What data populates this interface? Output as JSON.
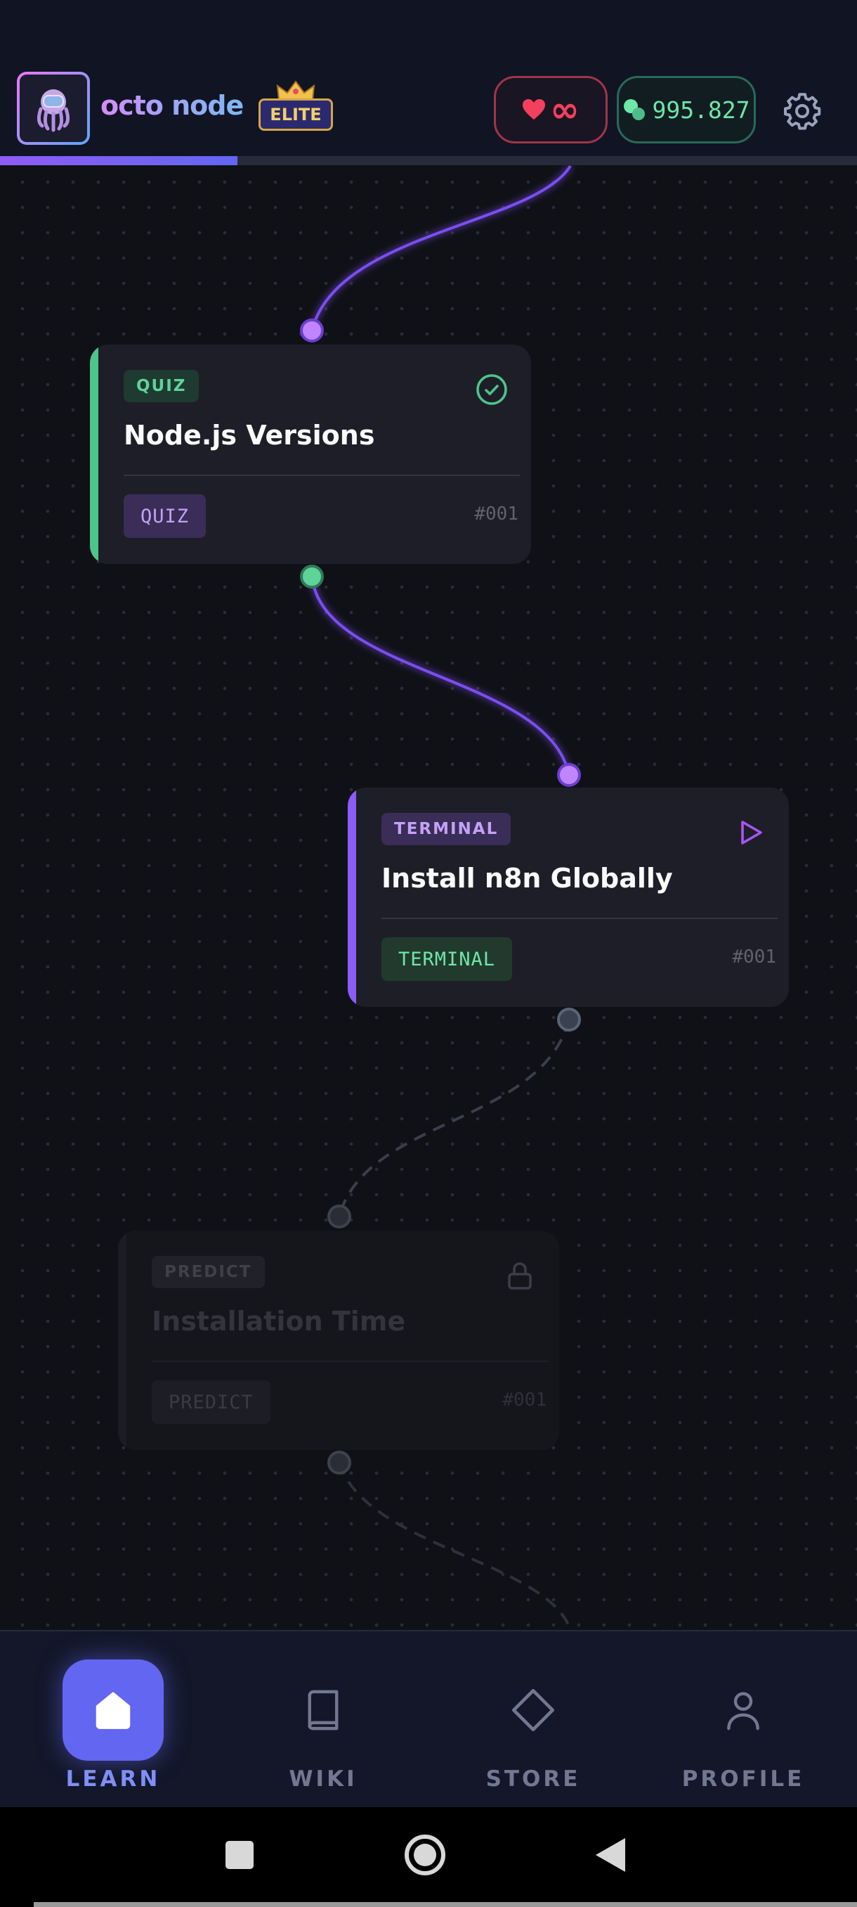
{
  "app": {
    "brand_name": "octo node",
    "elite_label": "ELITE"
  },
  "stats": {
    "hearts_value": "∞",
    "gems_value": "995.827"
  },
  "progress": {
    "fraction": 0.277
  },
  "colors": {
    "accent": "#6366f1",
    "purple": "#a855f7",
    "green": "#4ade80",
    "heart": "#f43f5e",
    "gem": "#6ee7a8"
  },
  "nodes": [
    {
      "badge": "QUIZ",
      "title": "Node.js Versions",
      "tag": "QUIZ",
      "number": "#001",
      "status": "completed",
      "status_icon": "check-circle-icon"
    },
    {
      "badge": "TERMINAL",
      "title": "Install n8n Globally",
      "tag": "TERMINAL",
      "number": "#001",
      "status": "current",
      "status_icon": "play-icon"
    },
    {
      "badge": "PREDICT",
      "title": "Installation Time",
      "tag": "PREDICT",
      "number": "#001",
      "status": "locked",
      "status_icon": "lock-icon"
    }
  ],
  "nav": {
    "items": [
      {
        "label": "LEARN",
        "icon": "home-icon",
        "active": true
      },
      {
        "label": "WIKI",
        "icon": "book-icon",
        "active": false
      },
      {
        "label": "STORE",
        "icon": "diamond-icon",
        "active": false
      },
      {
        "label": "PROFILE",
        "icon": "user-icon",
        "active": false
      }
    ]
  },
  "system_nav": {
    "buttons": [
      "recents-icon",
      "home-circle-icon",
      "back-icon"
    ]
  }
}
